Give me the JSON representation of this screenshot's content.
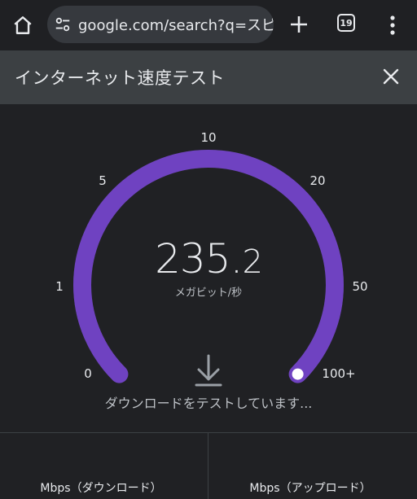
{
  "browser": {
    "url": "google.com/search?q=スピー",
    "tab_count": "19"
  },
  "panel": {
    "title": "インターネット速度テスト"
  },
  "gauge": {
    "value_int": "235.",
    "value_dec": "2",
    "unit": "メガビット/秒",
    "ticks": [
      "0",
      "1",
      "5",
      "10",
      "20",
      "50",
      "100+"
    ],
    "progress_fraction": 1.0,
    "accent_color": "#6f42c1",
    "status": "ダウンロードをテストしています..."
  },
  "results": {
    "download_label": "Mbps（ダウンロード）",
    "upload_label": "Mbps（アップロード）"
  }
}
